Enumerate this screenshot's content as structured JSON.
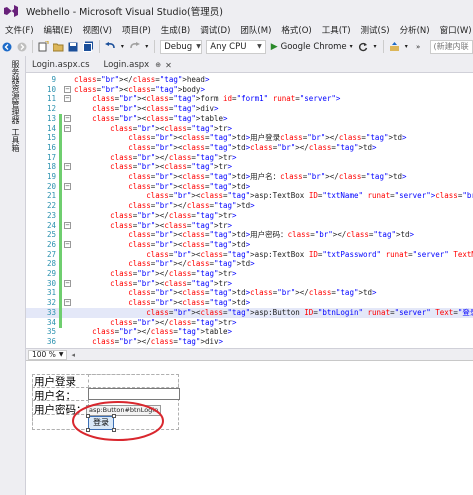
{
  "window": {
    "title": "Webhello - Microsoft Visual Studio(管理员)"
  },
  "menu": [
    "文件(F)",
    "编辑(E)",
    "视图(V)",
    "项目(P)",
    "生成(B)",
    "调试(D)",
    "团队(M)",
    "格式(O)",
    "工具(T)",
    "测试(S)",
    "分析(N)",
    "窗口(W)"
  ],
  "toolbar": {
    "config": "Debug",
    "platform": "Any CPU",
    "browser": "Google Chrome",
    "search_placeholder": "(新建内联"
  },
  "left_dock": {
    "tab1": "服务器资源管理器",
    "tab2": "工具箱"
  },
  "tabs": [
    {
      "label": "Login.aspx.cs",
      "active": false
    },
    {
      "label": "Login.aspx",
      "active": true
    }
  ],
  "code_lines": [
    {
      "n": "9",
      "text": "</head>"
    },
    {
      "n": "10",
      "text": "<body>"
    },
    {
      "n": "11",
      "text": "    <form id=\"form1\" runat=\"server\">"
    },
    {
      "n": "12",
      "text": "    <div>"
    },
    {
      "n": "13",
      "text": "    <table>"
    },
    {
      "n": "14",
      "text": "        <tr>"
    },
    {
      "n": "15",
      "text": "            <td>用户登录</td>"
    },
    {
      "n": "16",
      "text": "            <td></td>"
    },
    {
      "n": "17",
      "text": "        </tr>"
    },
    {
      "n": "18",
      "text": "        <tr>"
    },
    {
      "n": "19",
      "text": "            <td>用户名：</td>"
    },
    {
      "n": "20",
      "text": "            <td>"
    },
    {
      "n": "21",
      "text": "                <asp:TextBox ID=\"txtName\" runat=\"server\"></asp:TextBox>"
    },
    {
      "n": "22",
      "text": "            </td>"
    },
    {
      "n": "23",
      "text": "        </tr>"
    },
    {
      "n": "24",
      "text": "        <tr>"
    },
    {
      "n": "25",
      "text": "            <td>用户密码：</td>"
    },
    {
      "n": "26",
      "text": "            <td>"
    },
    {
      "n": "27",
      "text": "                <asp:TextBox ID=\"txtPassword\" runat=\"server\" TextMode=\"Password\"></asp:TextBox>"
    },
    {
      "n": "28",
      "text": "            </td>"
    },
    {
      "n": "29",
      "text": "        </tr>"
    },
    {
      "n": "30",
      "text": "        <tr>"
    },
    {
      "n": "31",
      "text": "            <td></td>"
    },
    {
      "n": "32",
      "text": "            <td>"
    },
    {
      "n": "33",
      "text": "                <asp:Button ID=\"btnLogin\" runat=\"server\" Text=\"登录\" /></td>"
    },
    {
      "n": "34",
      "text": "        </tr>"
    },
    {
      "n": "35",
      "text": "    </table>"
    },
    {
      "n": "36",
      "text": "    </div>"
    }
  ],
  "zoom": "100 %",
  "design": {
    "row1": "用户登录",
    "row2": "用户名：",
    "row3": "用户密码：",
    "smart_tag": "asp:Button#btnLogin",
    "button_text": "登录"
  },
  "colors": {
    "annotation": "#d9272e",
    "chrome_bg": "#eeeef2",
    "vs_purple": "#68217a"
  }
}
